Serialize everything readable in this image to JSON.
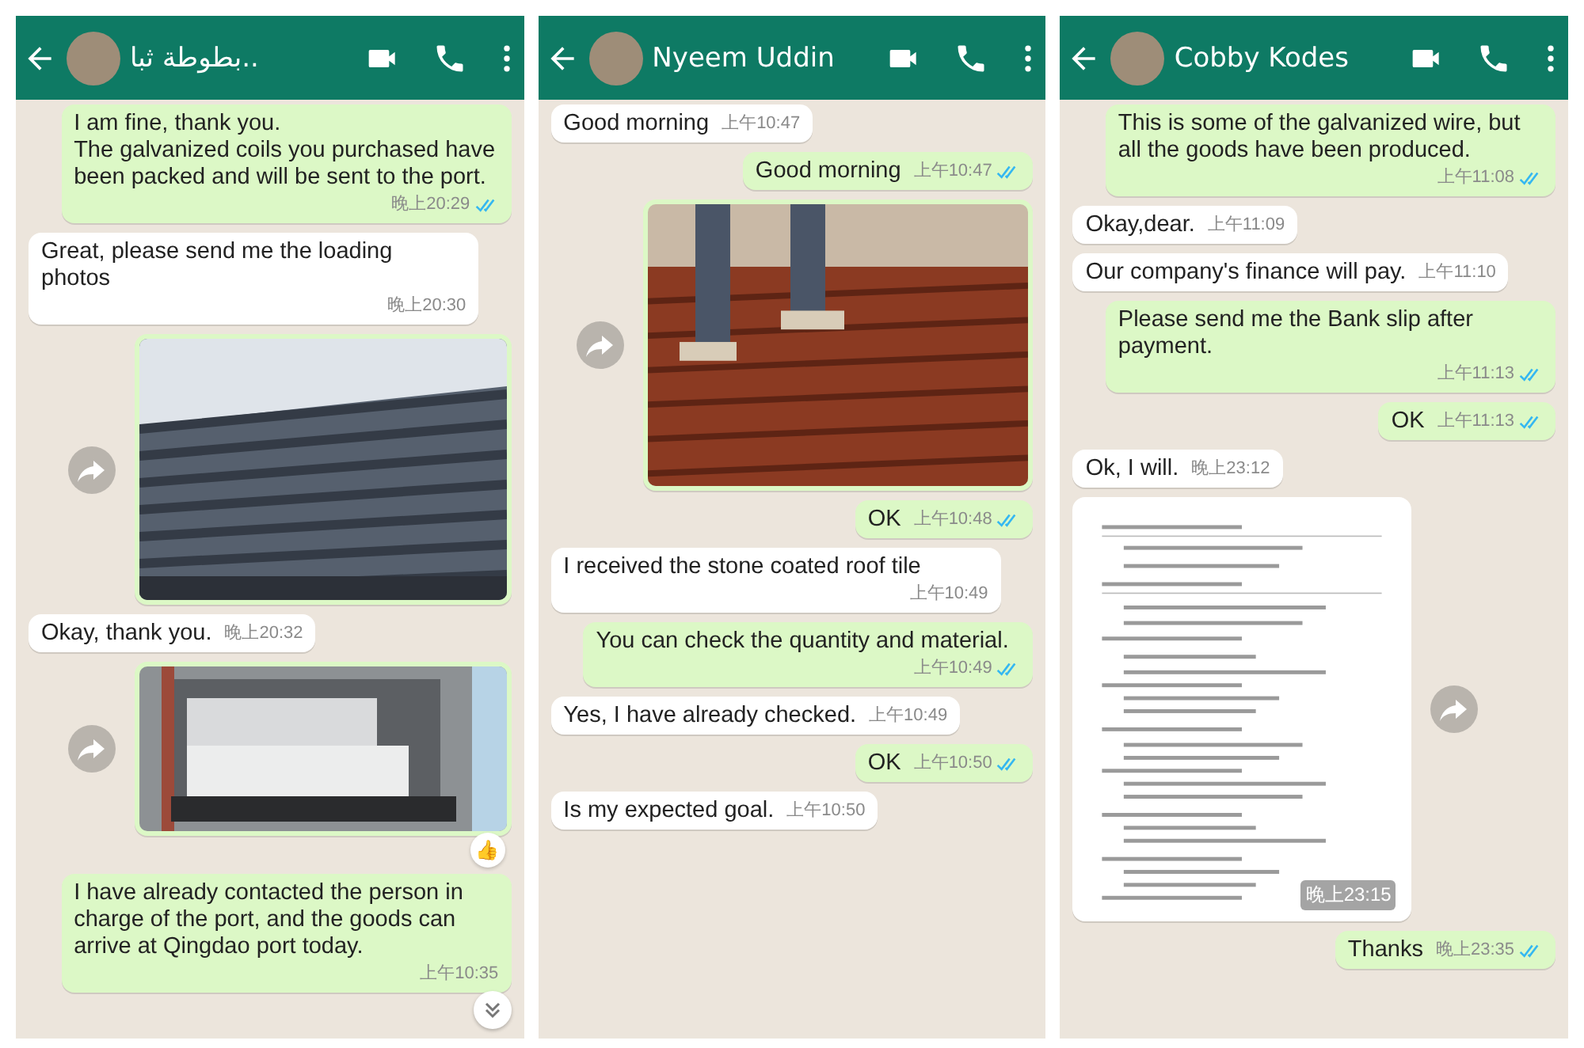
{
  "chats": [
    {
      "contact": {
        "name": "بطوطة ثبا.."
      },
      "scroll_button": true,
      "messages": [
        {
          "outgoing": true,
          "kind": "text",
          "text": "I am fine, thank you.\nThe galvanized coils you purchased have been packed and will be sent to the port.",
          "time": "晚上20:29",
          "read": true
        },
        {
          "outgoing": false,
          "kind": "text",
          "text": "Great, please send me the loading photos",
          "time": "晚上20:30"
        },
        {
          "outgoing": true,
          "kind": "roof-photo"
        },
        {
          "outgoing": false,
          "kind": "text",
          "text": "Okay, thank you.",
          "time": "晚上20:32"
        },
        {
          "outgoing": true,
          "kind": "container-photo",
          "reaction": "👍"
        },
        {
          "outgoing": true,
          "kind": "text",
          "text": "I have already contacted the person in charge of the port, and the goods can arrive at Qingdao port today.",
          "time": "上午10:35"
        }
      ]
    },
    {
      "contact": {
        "name": "Nyeem Uddin"
      },
      "scroll_button": false,
      "messages": [
        {
          "outgoing": false,
          "kind": "text",
          "text": "Good morning",
          "time": "上午10:47"
        },
        {
          "outgoing": true,
          "kind": "text",
          "text": "Good morning",
          "time": "上午10:47",
          "read": true
        },
        {
          "outgoing": true,
          "kind": "worker-photo"
        },
        {
          "outgoing": true,
          "kind": "text",
          "text": "OK",
          "time": "上午10:48",
          "read": true
        },
        {
          "outgoing": false,
          "kind": "text",
          "text": "I received the stone coated roof tile",
          "time": "上午10:49"
        },
        {
          "outgoing": true,
          "kind": "text",
          "text": "You can check the quantity and material.",
          "time": "上午10:49",
          "read": true
        },
        {
          "outgoing": false,
          "kind": "text",
          "text": "Yes, I have already checked.",
          "time": "上午10:49"
        },
        {
          "outgoing": true,
          "kind": "text",
          "text": "OK",
          "time": "上午10:50",
          "read": true
        },
        {
          "outgoing": false,
          "kind": "text",
          "text": "Is my expected goal.",
          "time": "上午10:50"
        }
      ]
    },
    {
      "contact": {
        "name": "Cobby Kodes"
      },
      "scroll_button": false,
      "messages": [
        {
          "outgoing": true,
          "kind": "text",
          "text": "This is some of the galvanized wire, but all the goods have been produced.",
          "time": "上午11:08",
          "read": true
        },
        {
          "outgoing": false,
          "kind": "text",
          "text": "Okay,dear.",
          "time": "上午11:09"
        },
        {
          "outgoing": false,
          "kind": "text",
          "text": "Our company's finance will pay.",
          "time": "上午11:10"
        },
        {
          "outgoing": true,
          "kind": "text",
          "text": "Please send me the Bank slip after payment.",
          "time": "上午11:13",
          "read": true
        },
        {
          "outgoing": true,
          "kind": "text",
          "text": "OK",
          "time": "上午11:13",
          "read": true
        },
        {
          "outgoing": false,
          "kind": "text",
          "text": "Ok, I will.",
          "time": "晚上23:12"
        },
        {
          "outgoing": false,
          "kind": "document",
          "time": "晚上23:15"
        },
        {
          "outgoing": true,
          "kind": "text",
          "text": "Thanks",
          "time": "晚上23:35",
          "read": true
        }
      ]
    }
  ]
}
